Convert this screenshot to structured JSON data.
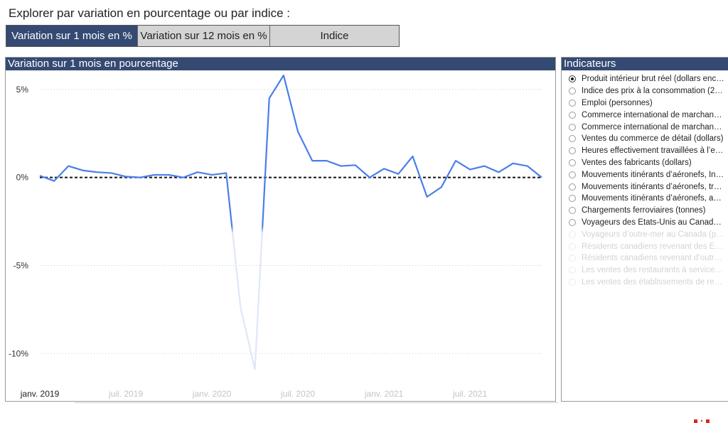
{
  "heading": "Explorer par variation en pourcentage ou par indice :",
  "tabs": [
    {
      "label": "Variation sur 1 mois en %",
      "active": true
    },
    {
      "label": "Variation sur 12 mois en %",
      "active": false
    },
    {
      "label": "Indice",
      "active": false
    }
  ],
  "chart_panel": {
    "title": "Variation sur 1 mois en pourcentage"
  },
  "indicators_panel": {
    "title": "Indicateurs",
    "items": [
      {
        "label": "Produit intérieur brut réel (dollars enc…",
        "selected": true
      },
      {
        "label": "Indice des prix à la consommation (2…",
        "selected": false
      },
      {
        "label": "Emploi (personnes)",
        "selected": false
      },
      {
        "label": "Commerce international de marchan…",
        "selected": false
      },
      {
        "label": "Commerce international de marchan…",
        "selected": false
      },
      {
        "label": "Ventes du commerce de détail (dollars)",
        "selected": false
      },
      {
        "label": "Heures effectivement travaillées à l’e…",
        "selected": false
      },
      {
        "label": "Ventes des fabricants (dollars)",
        "selected": false
      },
      {
        "label": "Mouvements itinérants d’aéronefs, In…",
        "selected": false
      },
      {
        "label": "Mouvements itinérants d’aéronefs, tr…",
        "selected": false
      },
      {
        "label": "Mouvements itinérants d’aéronefs, a…",
        "selected": false
      },
      {
        "label": "Chargements ferroviaires (tonnes)",
        "selected": false
      },
      {
        "label": "Voyageurs des États-Unis au Canad…",
        "selected": false
      },
      {
        "label": "Voyageurs d’outre-mer au Canada (p…",
        "selected": false
      },
      {
        "label": "Résidents canadiens revenant des É…",
        "selected": false
      },
      {
        "label": "Résidents canadiens revenant d’outr…",
        "selected": false
      },
      {
        "label": "Les ventes des restaurants à service…",
        "selected": false
      },
      {
        "label": "Les ventes des établissements de re…",
        "selected": false
      }
    ]
  },
  "chart_data": {
    "type": "line",
    "title": "Variation sur 1 mois en pourcentage",
    "xlabel": "",
    "ylabel": "",
    "y_ticks": [
      {
        "value": 5,
        "label": "5%"
      },
      {
        "value": 0,
        "label": "0%"
      },
      {
        "value": -5,
        "label": "-5%"
      },
      {
        "value": -10,
        "label": "-10%"
      }
    ],
    "ylim": [
      -11.2,
      5.8
    ],
    "x_ticks": [
      {
        "index": 0,
        "label": "janv. 2019"
      },
      {
        "index": 6,
        "label": "juil. 2019"
      },
      {
        "index": 12,
        "label": "janv. 2020"
      },
      {
        "index": 18,
        "label": "juil. 2020"
      },
      {
        "index": 24,
        "label": "janv. 2021"
      },
      {
        "index": 30,
        "label": "juil. 2021"
      }
    ],
    "x": [
      "janv. 2019",
      "févr. 2019",
      "mars 2019",
      "avr. 2019",
      "mai 2019",
      "juin 2019",
      "juil. 2019",
      "août 2019",
      "sept. 2019",
      "oct. 2019",
      "nov. 2019",
      "déc. 2019",
      "janv. 2020",
      "févr. 2020",
      "mars 2020",
      "avr. 2020",
      "mai 2020",
      "juin 2020",
      "juil. 2020",
      "août 2020",
      "sept. 2020",
      "oct. 2020",
      "nov. 2020",
      "déc. 2020",
      "janv. 2021",
      "févr. 2021",
      "mars 2021",
      "avr. 2021",
      "mai 2021",
      "juin 2021",
      "juil. 2021",
      "août 2021",
      "sept. 2021",
      "oct. 2021",
      "nov. 2021",
      "déc. 2021"
    ],
    "series": [
      {
        "color": "#4a7ee8",
        "values": [
          0.1,
          -0.2,
          0.65,
          0.4,
          0.3,
          0.25,
          0.05,
          0.0,
          0.15,
          0.15,
          0.0,
          0.3,
          0.15,
          0.25,
          -7.4,
          -10.9,
          4.5,
          5.8,
          2.6,
          0.95,
          0.95,
          0.65,
          0.7,
          0.0,
          0.5,
          0.2,
          1.2,
          -1.1,
          -0.55,
          0.95,
          0.45,
          0.65,
          0.3,
          0.8,
          0.65,
          0.0
        ]
      }
    ],
    "reference_line": {
      "value": 0,
      "style": "dashed",
      "color": "#111111"
    },
    "grid": "horizontal dotted"
  }
}
